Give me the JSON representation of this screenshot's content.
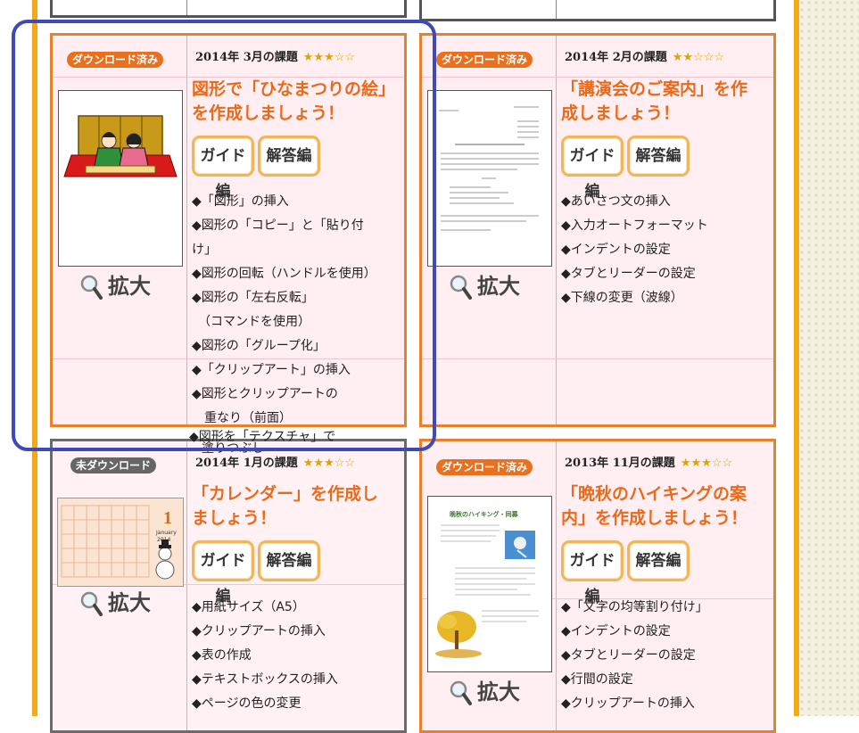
{
  "colors": {
    "accent": "#ea6a1a",
    "card_border": "#e8812e",
    "highlight": "#3d4ab8",
    "side_border": "#f4a919"
  },
  "cards": [
    {
      "badge": "ダウンロード済み",
      "issue": "2014年 3月の課題",
      "stars": "★★★☆☆",
      "title": "図形で「ひなまつりの絵」を作成しましょう！",
      "guide_label": "ガイド編",
      "answer_label": "解答編",
      "zoom_label": "拡大",
      "thumbnail": "hinamatsuri-illustration",
      "bullets": [
        "◆「図形」の挿入",
        "◆図形の「コピー」と「貼り付",
        "け」",
        "◆図形の回転（ハンドルを使用）",
        "◆図形の「左右反転」",
        "　（コマンドを使用）",
        "◆図形の「グループ化」",
        "◆「クリップアート」の挿入",
        "◆図形とクリップアートの",
        "　重なり（前面）",
        "◆図形を「テクスチャ」で",
        "　塗りつぶし"
      ]
    },
    {
      "badge": "ダウンロード済み",
      "issue": "2014年 2月の課題",
      "stars": "★★☆☆☆",
      "title": "「講演会のご案内」を作成しましょう！",
      "guide_label": "ガイド編",
      "answer_label": "解答編",
      "zoom_label": "拡大",
      "thumbnail": "lecture-document",
      "bullets": [
        "◆あいさつ文の挿入",
        "◆入力オートフォーマット",
        "◆インデントの設定",
        "◆タブとリーダーの設定",
        "◆下線の変更（波線）"
      ]
    },
    {
      "badge": "未ダウンロード",
      "issue": "2014年 1月の課題",
      "stars": "★★★☆☆",
      "title": "「カレンダー」を作成しましょう！",
      "guide_label": "ガイド編",
      "answer_label": "解答編",
      "zoom_label": "拡大",
      "thumbnail": "calendar",
      "calendar_month": "1",
      "calendar_name": "January",
      "calendar_year": "2014",
      "bullets": [
        "◆用紙サイズ（A5）",
        "◆クリップアートの挿入",
        "◆表の作成",
        "◆テキストボックスの挿入",
        "◆ページの色の変更"
      ]
    },
    {
      "badge": "ダウンロード済み",
      "issue": "2013年 11月の課題",
      "stars": "★★★☆☆",
      "title": "「晩秋のハイキングの案内」を作成しましょう！",
      "guide_label": "ガイド編",
      "answer_label": "解答編",
      "zoom_label": "拡大",
      "thumbnail": "hiking-flyer",
      "thumb_heading": "晩秋のハイキング・同募",
      "bullets": [
        "◆「文字の均等割り付け」",
        "◆インデントの設定",
        "◆タブとリーダーの設定",
        "◆行間の設定",
        "◆クリップアートの挿入"
      ]
    }
  ]
}
